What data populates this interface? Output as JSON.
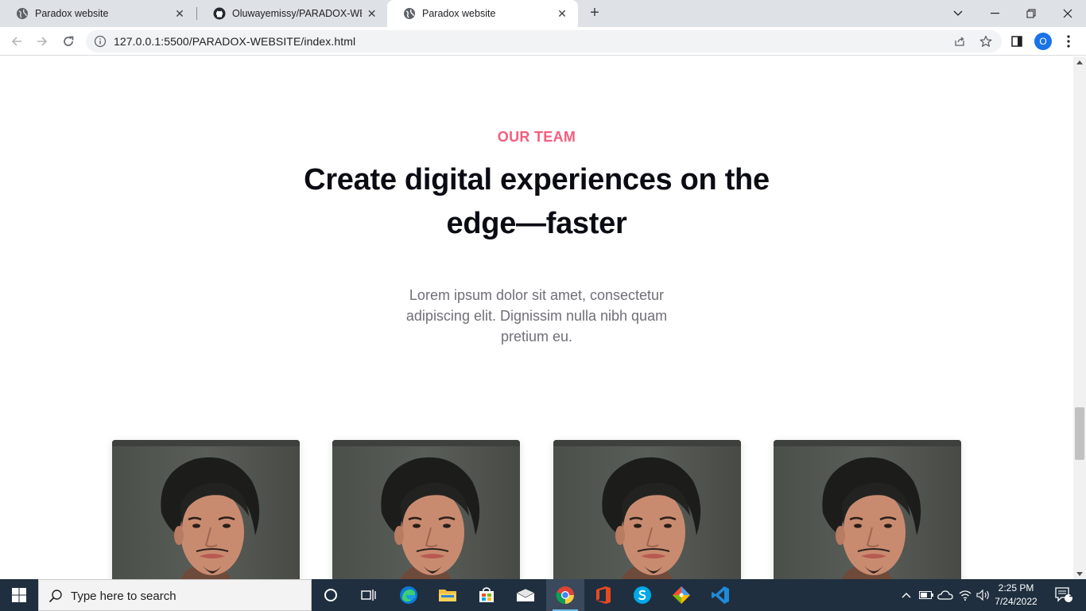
{
  "browser": {
    "tabs": [
      {
        "title": "Paradox website",
        "active": false,
        "favicon": "globe-icon"
      },
      {
        "title": "Oluwayemissy/PARADOX-WEBSITE",
        "active": false,
        "favicon": "github-icon"
      },
      {
        "title": "Paradox website",
        "active": true,
        "favicon": "globe-icon"
      }
    ],
    "url": "127.0.0.1:5500/PARADOX-WEBSITE/index.html",
    "profile_initial": "O"
  },
  "page": {
    "eyebrow": "OUR TEAM",
    "headline": "Create digital experiences on the edge—faster",
    "description": "Lorem ipsum dolor sit amet, consectetur adipiscing elit. Dignissim nulla nibh quam pretium eu.",
    "team_photos": [
      {
        "name": "team-member-photo-1"
      },
      {
        "name": "team-member-photo-2"
      },
      {
        "name": "team-member-photo-3"
      },
      {
        "name": "team-member-photo-4"
      }
    ],
    "scroll_position": 0.72
  },
  "colors": {
    "accent": "#f45d7e",
    "heading": "#0b0b14",
    "body_text": "#6f6f77",
    "taskbar": "#1f2f3f"
  },
  "taskbar": {
    "search_placeholder": "Type here to search",
    "time": "2:25 PM",
    "date": "7/24/2022",
    "notification_count": "1",
    "apps": [
      "cortana-icon",
      "task-view-icon",
      "edge-icon",
      "file-explorer-icon",
      "store-icon",
      "mail-icon",
      "chrome-icon",
      "office-icon",
      "skype-icon",
      "git-icon",
      "vscode-icon"
    ]
  }
}
